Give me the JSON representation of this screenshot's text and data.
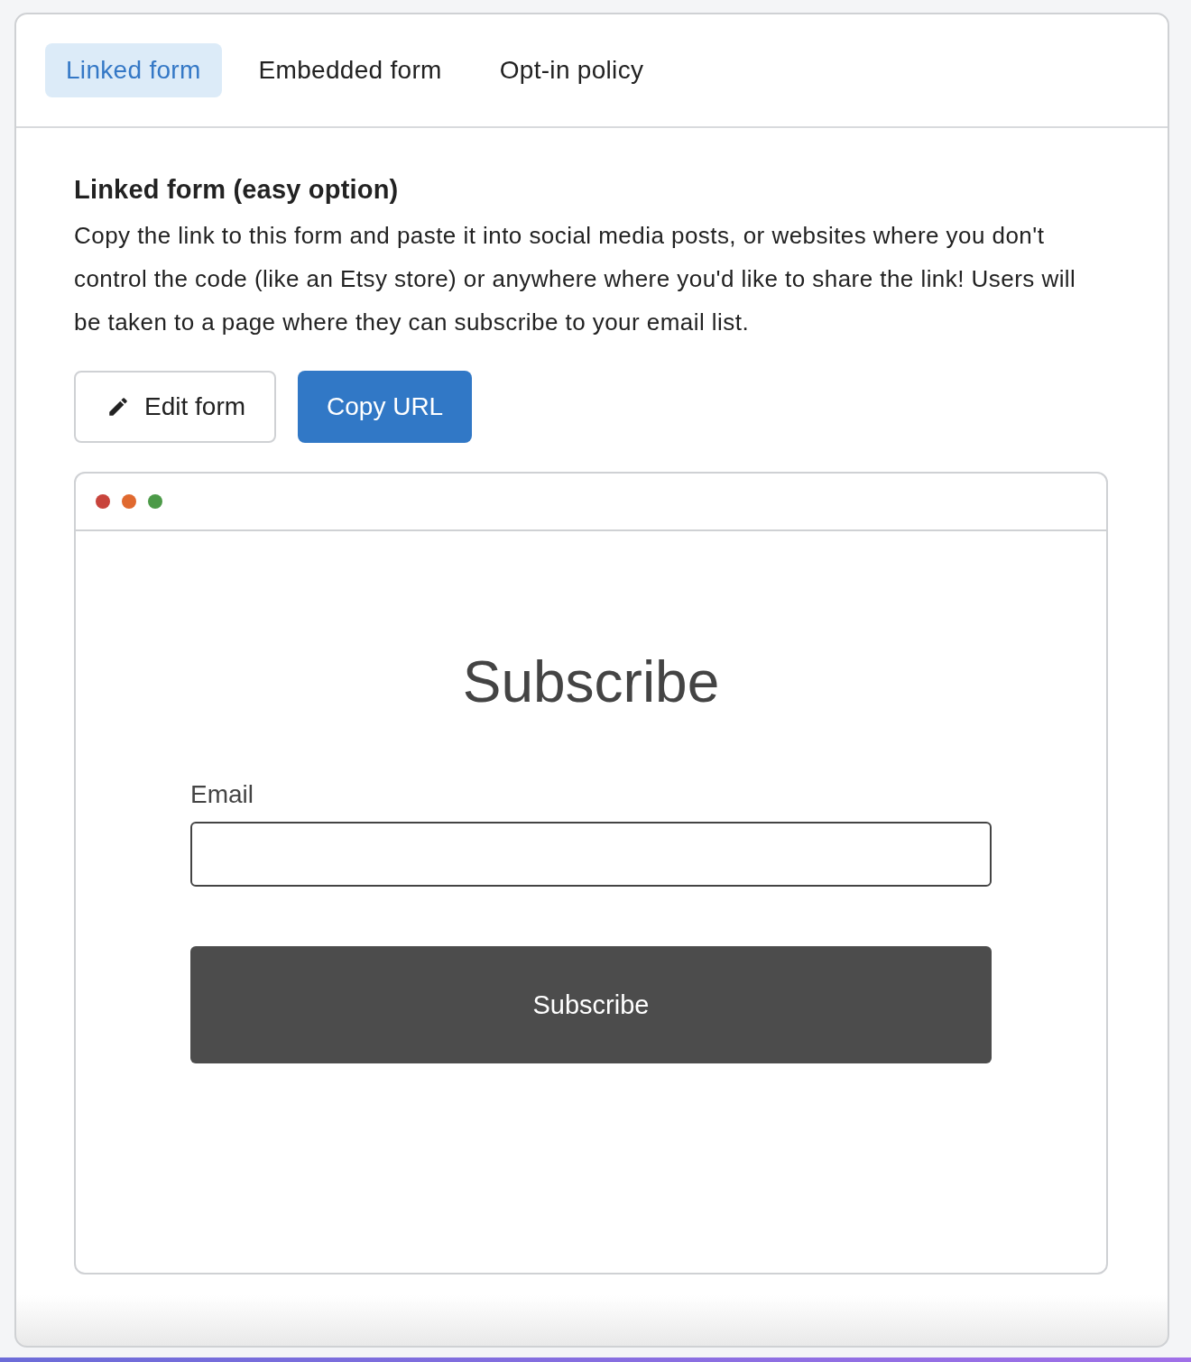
{
  "tabs": [
    {
      "label": "Linked form",
      "selected": true
    },
    {
      "label": "Embedded form",
      "selected": false
    },
    {
      "label": "Opt-in policy",
      "selected": false
    }
  ],
  "section": {
    "title": "Linked form (easy option)",
    "description": "Copy the link to this form and paste it into social media posts, or websites where you don't control the code (like an Etsy store) or anywhere where you'd like to share the link! Users will be taken to a page where they can subscribe to your email list."
  },
  "buttons": [
    {
      "label": "Edit form",
      "kind": "secondary"
    },
    {
      "label": "Copy URL",
      "kind": "primary"
    }
  ],
  "preview": {
    "window_dots": [
      {
        "color": "#c8443c"
      },
      {
        "color": "#e0692f"
      },
      {
        "color": "#4c9a48"
      }
    ],
    "heading": "Subscribe",
    "email_label": "Email",
    "submit": "Subscribe"
  }
}
